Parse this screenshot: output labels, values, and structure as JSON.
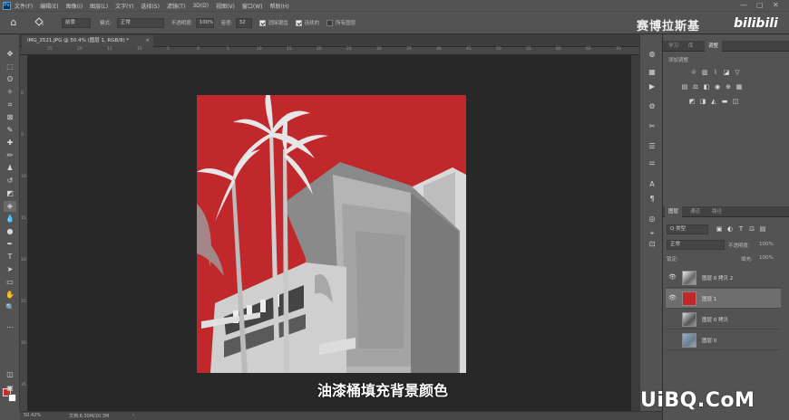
{
  "menubar": {
    "logo": "Ps",
    "items": [
      "文件(F)",
      "编辑(E)",
      "图像(I)",
      "图层(L)",
      "文字(Y)",
      "选择(S)",
      "滤镜(T)",
      "3D(D)",
      "视图(V)",
      "窗口(W)",
      "帮助(H)"
    ],
    "window_controls": [
      "—",
      "▢",
      "✕"
    ]
  },
  "options_bar": {
    "fill_source": "前景",
    "mode_label": "模式:",
    "mode_value": "正常",
    "opacity_label": "不透明度:",
    "opacity_value": "100%",
    "tolerance_label": "容差:",
    "tolerance_value": "32",
    "antialias_label": "消除锯齿",
    "contiguous_label": "连续的",
    "all_layers_label": "所有图层"
  },
  "watermark": {
    "title": "赛博拉斯基",
    "logo_text": "bilibili",
    "site": "UiBQ.CoM"
  },
  "document": {
    "tab_title": "IMG_2521.JPG @ 50.4% (图层 1, RGB/8) *",
    "tab_close": "×",
    "bg_color": "#c0282b",
    "subtitle": "油漆桶填充背景颜色"
  },
  "ruler": {
    "h_ticks": [
      "25",
      "20",
      "15",
      "10",
      "5",
      "0",
      "5",
      "10",
      "15",
      "20",
      "25",
      "30",
      "35",
      "40",
      "45",
      "50",
      "55",
      "60",
      "65",
      "70",
      "75"
    ],
    "v_ticks": [
      "0",
      "5",
      "10",
      "15",
      "20",
      "25",
      "30",
      "35"
    ]
  },
  "statusbar": {
    "zoom": "50.42%",
    "doc_info": "文档:6.30M/20.3M",
    "arrow": "›"
  },
  "panels": {
    "top_tabs": [
      "学习",
      "库",
      "调整"
    ],
    "adjust_header": "添加调整",
    "layers_tabs": [
      "图层",
      "通道",
      "路径"
    ],
    "filter_label": "Q 类型",
    "blend_mode": "正常",
    "opacity_label": "不透明度:",
    "opacity_value": "100%",
    "fill_label": "填充:",
    "fill_value": "100%",
    "lock_label": "锁定:",
    "layers": [
      {
        "name": "图层 0 拷贝 2",
        "visible": true,
        "selected": false,
        "thumb": "photo"
      },
      {
        "name": "图层 1",
        "visible": true,
        "selected": true,
        "thumb": "red"
      },
      {
        "name": "图层 0 拷贝",
        "visible": false,
        "selected": false,
        "thumb": "photo"
      },
      {
        "name": "图层 0",
        "visible": false,
        "selected": false,
        "thumb": "photo-color"
      }
    ]
  },
  "colors": {
    "foreground": "#c5302d",
    "background": "#ffffff",
    "accent": "#31a8ff"
  }
}
